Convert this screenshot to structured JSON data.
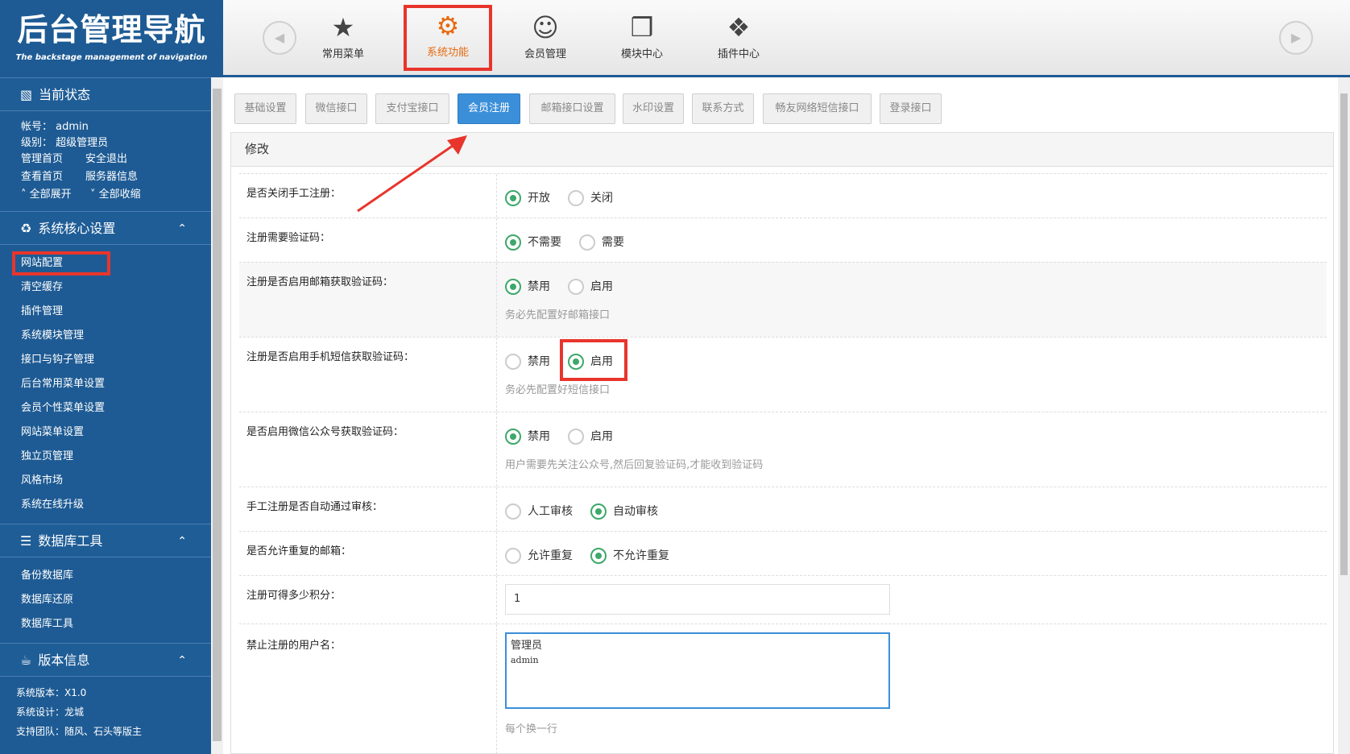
{
  "brand": {
    "title": "后台管理导航",
    "subtitle": "The backstage management of navigation"
  },
  "topnav": {
    "items": [
      {
        "label": "常用菜单",
        "icon": "star-icon"
      },
      {
        "label": "系统功能",
        "icon": "gear-icon"
      },
      {
        "label": "会员管理",
        "icon": "user-icon"
      },
      {
        "label": "模块中心",
        "icon": "cubes-icon"
      },
      {
        "label": "插件中心",
        "icon": "puzzle-icon"
      }
    ],
    "active": "系统功能"
  },
  "sidebar": {
    "status": {
      "title": "当前状态",
      "account_label": "帐号：",
      "account_value": "admin",
      "level_label": "级别：",
      "level_value": "超级管理员",
      "links": [
        "管理首页",
        "安全退出",
        "查看首页",
        "服务器信息"
      ],
      "expand_all": "全部展开",
      "collapse_all": "全部收缩"
    },
    "core": {
      "title": "系统核心设置",
      "items": [
        "网站配置",
        "清空缓存",
        "插件管理",
        "系统模块管理",
        "接口与钩子管理",
        "后台常用菜单设置",
        "会员个性菜单设置",
        "网站菜单设置",
        "独立页管理",
        "风格市场",
        "系统在线升级"
      ]
    },
    "db": {
      "title": "数据库工具",
      "items": [
        "备份数据库",
        "数据库还原",
        "数据库工具"
      ]
    },
    "version": {
      "title": "版本信息",
      "lines": [
        "系统版本：X1.0",
        "系统设计：龙城",
        "支持团队：随风、石头等版主"
      ]
    }
  },
  "tabs": [
    "基础设置",
    "微信接口",
    "支付宝接口",
    "会员注册",
    "邮箱接口设置",
    "水印设置",
    "联系方式",
    "畅友网络短信接口",
    "登录接口"
  ],
  "active_tab": "会员注册",
  "panel": {
    "title": "修改",
    "rows": {
      "r1": {
        "label": "是否关闭手工注册：",
        "opts": [
          "开放",
          "关闭"
        ],
        "selected": "开放"
      },
      "r2": {
        "label": "注册需要验证码：",
        "opts": [
          "不需要",
          "需要"
        ],
        "selected": "不需要"
      },
      "r3": {
        "label": "注册是否启用邮箱获取验证码：",
        "opts": [
          "禁用",
          "启用"
        ],
        "selected": "禁用",
        "hint": "务必先配置好邮箱接口"
      },
      "r4": {
        "label": "注册是否启用手机短信获取验证码：",
        "opts": [
          "禁用",
          "启用"
        ],
        "selected": "启用",
        "hint": "务必先配置好短信接口"
      },
      "r5": {
        "label": "是否启用微信公众号获取验证码：",
        "opts": [
          "禁用",
          "启用"
        ],
        "selected": "禁用",
        "hint": "用户需要先关注公众号,然后回复验证码,才能收到验证码"
      },
      "r6": {
        "label": "手工注册是否自动通过审核：",
        "opts": [
          "人工审核",
          "自动审核"
        ],
        "selected": "自动审核"
      },
      "r7": {
        "label": "是否允许重复的邮箱：",
        "opts": [
          "允许重复",
          "不允许重复"
        ],
        "selected": "不允许重复"
      },
      "r8": {
        "label": "注册可得多少积分：",
        "value": "1"
      },
      "r9": {
        "label": "禁止注册的用户名：",
        "line1": "管理员",
        "line2": "admin",
        "hint": "每个换一行"
      }
    }
  },
  "colors": {
    "brand": "#1e5b94",
    "highlight": "#e8352c",
    "radio": "#3ea86a",
    "active_tab": "#3b8fd9",
    "active_nav": "#e86a10"
  }
}
